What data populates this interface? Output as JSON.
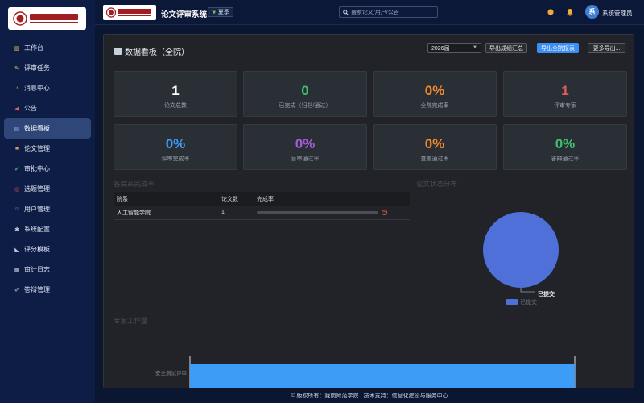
{
  "app": {
    "title": "论文评审系统",
    "season": "夏季",
    "season_icon": "leaf-icon"
  },
  "logo": {
    "alt": "陇南师范学院"
  },
  "search": {
    "placeholder": "搜索论文/用户/公告"
  },
  "user": {
    "avatar_text": "系",
    "name": "系统管理员"
  },
  "sidebar": {
    "items": [
      {
        "label": "工作台",
        "icon": "bar-chart-icon",
        "color": "#e8c25a"
      },
      {
        "label": "评审任务",
        "icon": "pen-icon",
        "color": "#e8c25a"
      },
      {
        "label": "消息中心",
        "icon": "bell-icon",
        "color": "#f2b134"
      },
      {
        "label": "公告",
        "icon": "megaphone-icon",
        "color": "#e25b5b"
      },
      {
        "label": "数据看板",
        "icon": "dashboard-icon",
        "color": "#9fb7e8",
        "active": true
      },
      {
        "label": "论文管理",
        "icon": "box-icon",
        "color": "#d8945a"
      },
      {
        "label": "审批中心",
        "icon": "check-icon",
        "color": "#3fbf6a"
      },
      {
        "label": "选题管理",
        "icon": "target-icon",
        "color": "#e25b5b"
      },
      {
        "label": "用户管理",
        "icon": "users-icon",
        "color": "#8e7be0"
      },
      {
        "label": "系统配置",
        "icon": "gear-icon",
        "color": "#c8d0de"
      },
      {
        "label": "评分模板",
        "icon": "ruler-icon",
        "color": "#c8d0de"
      },
      {
        "label": "审计日志",
        "icon": "log-icon",
        "color": "#c8d0de"
      },
      {
        "label": "答辩管理",
        "icon": "mic-icon",
        "color": "#c8d0de"
      }
    ]
  },
  "dashboard": {
    "title": "数据看板（全院）",
    "year": "2026届",
    "buttons": {
      "export_grades": "导出成绩汇总",
      "export_report": "导出全院报表",
      "more_export": "更多导出..."
    },
    "stats": [
      {
        "value": "1",
        "label": "论文总数",
        "color": "#ffffff"
      },
      {
        "value": "0",
        "label": "已完成（归档/通过）",
        "color": "#3fbf6a"
      },
      {
        "value": "0%",
        "label": "全院完成率",
        "color": "#f08a2c"
      },
      {
        "value": "1",
        "label": "评审专家",
        "color": "#e25b5b"
      },
      {
        "value": "0%",
        "label": "评审完成率",
        "color": "#3d9cf5"
      },
      {
        "value": "0%",
        "label": "盲审通过率",
        "color": "#a45bd6"
      },
      {
        "value": "0%",
        "label": "查重通过率",
        "color": "#f08a2c"
      },
      {
        "value": "0%",
        "label": "答辩通过率",
        "color": "#3fbf6a"
      }
    ],
    "dept_section_title": "各院系完成率",
    "dept_table": {
      "headers": [
        "院系",
        "论文数",
        "完成率"
      ],
      "rows": [
        {
          "dept": "人工智能学院",
          "count": "1",
          "completion": 0
        }
      ]
    },
    "status_section_title": "论文状态分布",
    "expert_section_title": "专家工作量"
  },
  "chart_data": [
    {
      "type": "pie",
      "title": "论文状态分布",
      "categories": [
        "已提交"
      ],
      "values": [
        1
      ],
      "colors": [
        "#4f6fd9"
      ],
      "slice_labels": [
        "已提交"
      ],
      "legend": "bottom"
    },
    {
      "type": "bar",
      "orientation": "horizontal",
      "title": "专家工作量",
      "categories": [
        "安全测试评审"
      ],
      "values": [
        1
      ],
      "colors": [
        "#3d9cf5"
      ]
    }
  ],
  "footer": {
    "text": "© 版权所有：陇南师范学院 · 技术支持：信息化建设与服务中心"
  }
}
